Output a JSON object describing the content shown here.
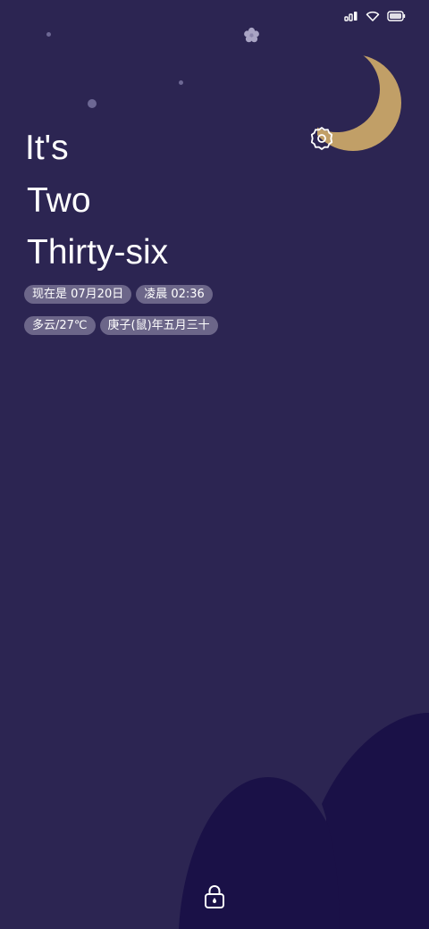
{
  "status_bar": {
    "icons": [
      "signal-icon",
      "wifi-icon",
      "battery-icon"
    ]
  },
  "clock": {
    "line1": "It's",
    "line2": "Two",
    "line3": "Thirty-six"
  },
  "info_chips": {
    "date": "现在是 07月20日",
    "time": "凌晨 02:36",
    "weather": "多云/27℃",
    "lunar_date": "庚子(鼠)年五月三十"
  },
  "colors": {
    "background": "#2c2552",
    "moon": "#c19f67",
    "hill": "#1a1147",
    "chip": "#6c6689"
  }
}
